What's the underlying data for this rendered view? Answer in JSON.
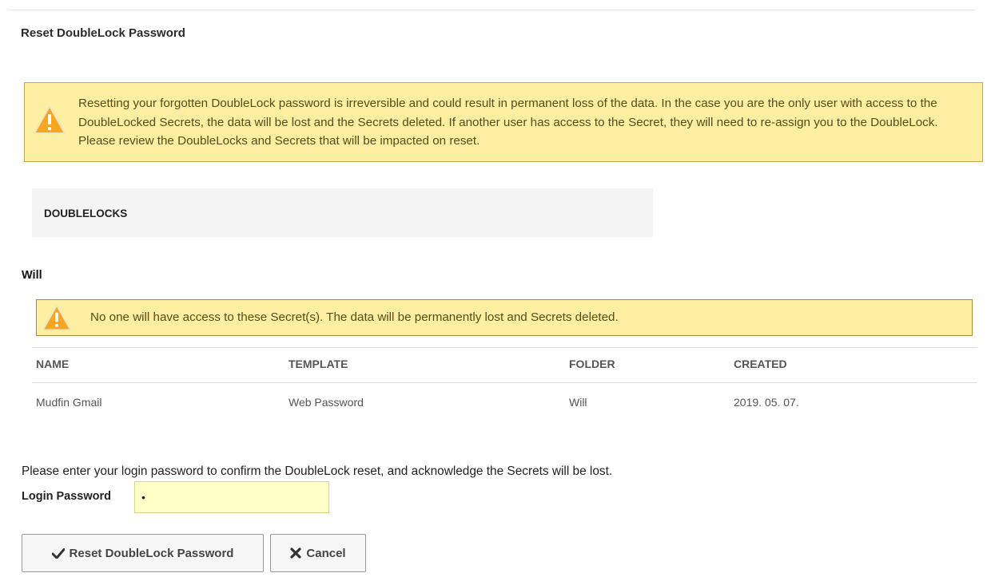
{
  "page": {
    "title": "Reset DoubleLock Password"
  },
  "warning": {
    "icon": "warning-triangle-icon",
    "text": "Resetting your forgotten DoubleLock password is irreversible and could result in permanent loss of the data. In the case you are the only user with access to the DoubleLocked Secrets, the data will be lost and the Secrets deleted. If another user has access to the Secret, they will need to re-assign you to the DoubleLock. Please review the DoubleLocks and Secrets that will be impacted on reset."
  },
  "doublelocks": {
    "header": "DOUBLELOCKS",
    "group": {
      "name": "Will",
      "warning": {
        "icon": "warning-triangle-icon",
        "text": "No one will have access to these Secret(s). The data will be permanently lost and Secrets deleted."
      },
      "table": {
        "columns": [
          "NAME",
          "TEMPLATE",
          "FOLDER",
          "CREATED"
        ],
        "rows": [
          [
            "Mudfin Gmail",
            "Web Password",
            "Will",
            "2019. 05. 07."
          ]
        ]
      }
    }
  },
  "confirm": {
    "text": "Please enter your login password to confirm the DoubleLock reset, and acknowledge the Secrets will be lost.",
    "password_label": "Login Password",
    "password_value": "•"
  },
  "buttons": {
    "reset": {
      "label": "Reset DoubleLock Password",
      "icon": "check-icon"
    },
    "cancel": {
      "label": "Cancel",
      "icon": "close-icon"
    }
  },
  "colors": {
    "warning_bg": "#fcefa1",
    "warning_border": "#c8a84c",
    "warning_icon": "#f5a623",
    "input_bg": "#ffffc8"
  }
}
